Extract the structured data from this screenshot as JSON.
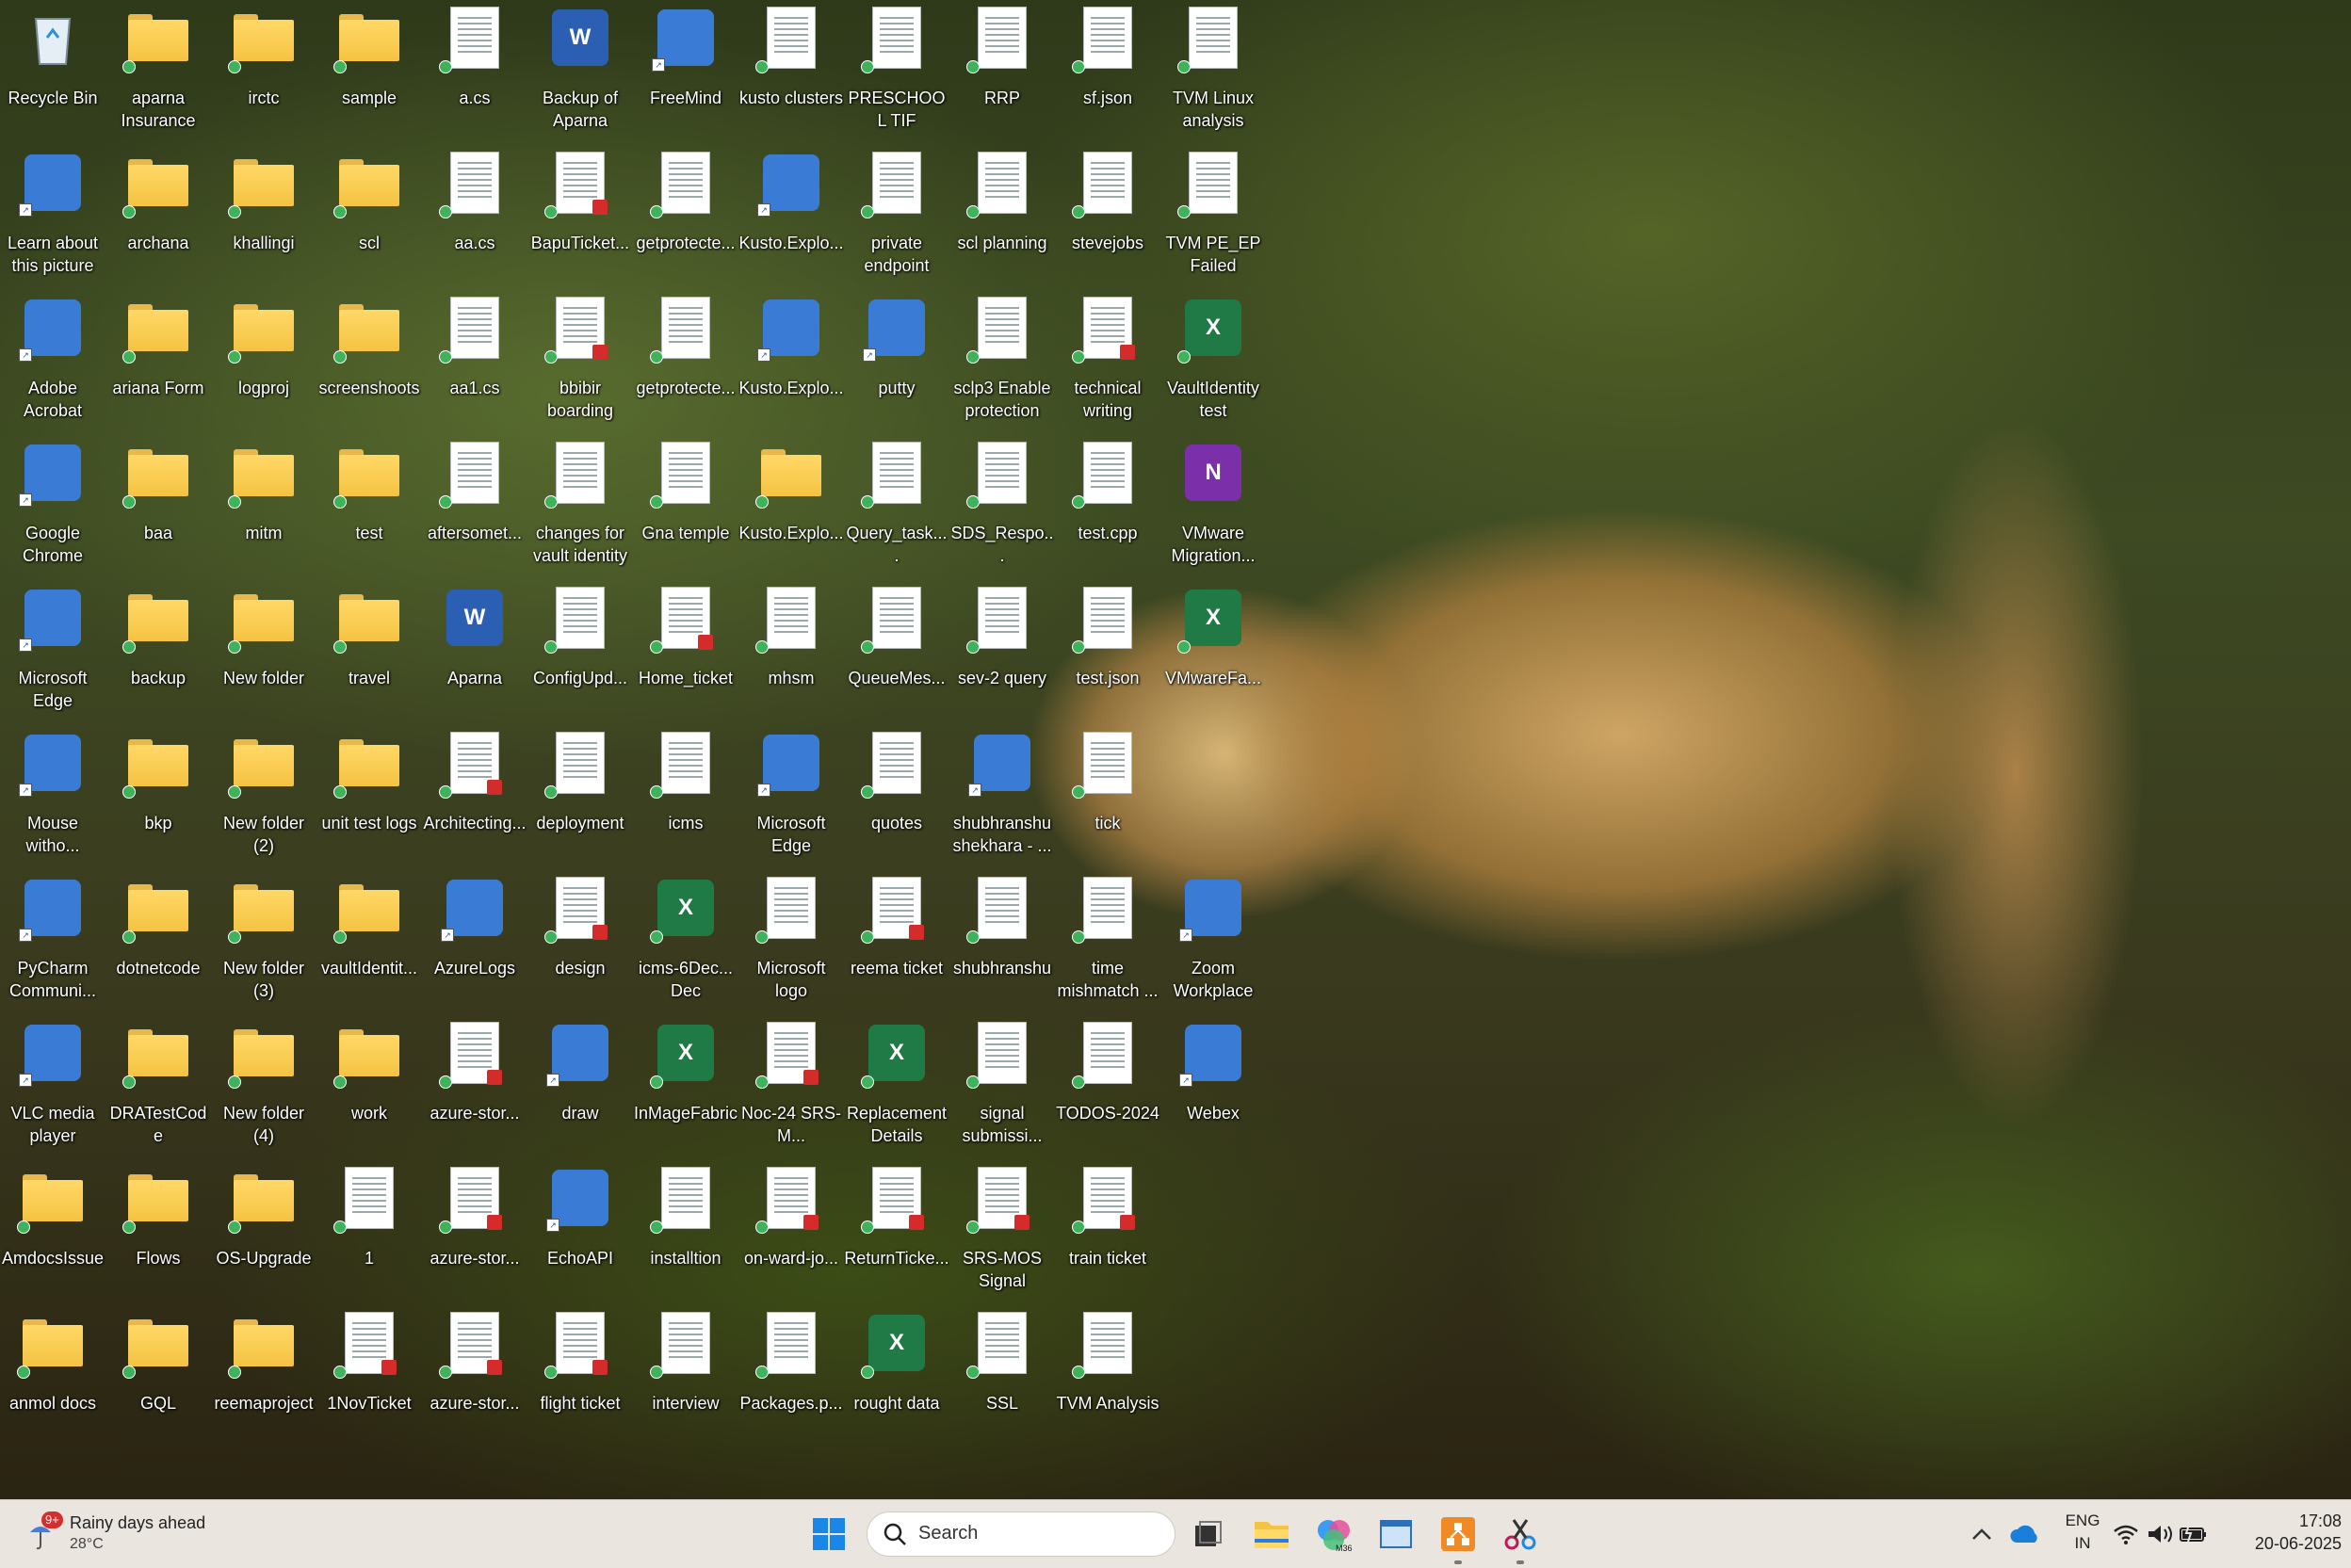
{
  "desktop": {
    "icons": [
      {
        "label": "Recycle Bin",
        "kind": "bin"
      },
      {
        "label": "aparna Insurance",
        "kind": "folder"
      },
      {
        "label": "irctc",
        "kind": "folder"
      },
      {
        "label": "sample",
        "kind": "folder"
      },
      {
        "label": "a.cs",
        "kind": "doc"
      },
      {
        "label": "Backup of Aparna",
        "kind": "word"
      },
      {
        "label": "FreeMind",
        "kind": "app"
      },
      {
        "label": "kusto clusters",
        "kind": "doc"
      },
      {
        "label": "PRESCHOOL TIF",
        "kind": "doc"
      },
      {
        "label": "RRP",
        "kind": "doc"
      },
      {
        "label": "sf.json",
        "kind": "doc"
      },
      {
        "label": "TVM Linux analysis",
        "kind": "doc"
      },
      {
        "label": "Learn about this picture",
        "kind": "app"
      },
      {
        "label": "archana",
        "kind": "folder"
      },
      {
        "label": "khallingi",
        "kind": "folder"
      },
      {
        "label": "scl",
        "kind": "folder"
      },
      {
        "label": "aa.cs",
        "kind": "doc"
      },
      {
        "label": "BapuTicket...",
        "kind": "pdf"
      },
      {
        "label": "getprotecte...",
        "kind": "doc"
      },
      {
        "label": "Kusto.Explo...",
        "kind": "app"
      },
      {
        "label": "private endpoint",
        "kind": "doc"
      },
      {
        "label": "scl planning",
        "kind": "doc"
      },
      {
        "label": "stevejobs",
        "kind": "doc"
      },
      {
        "label": "TVM PE_EP Failed",
        "kind": "doc"
      },
      {
        "label": "Adobe Acrobat",
        "kind": "app"
      },
      {
        "label": "ariana Form",
        "kind": "folder"
      },
      {
        "label": "logproj",
        "kind": "folder"
      },
      {
        "label": "screenshoots",
        "kind": "folder"
      },
      {
        "label": "aa1.cs",
        "kind": "doc"
      },
      {
        "label": "bbibir boarding",
        "kind": "pdf"
      },
      {
        "label": "getprotecte...",
        "kind": "doc"
      },
      {
        "label": "Kusto.Explo...",
        "kind": "app"
      },
      {
        "label": "putty",
        "kind": "app"
      },
      {
        "label": "sclp3 Enable protection",
        "kind": "doc"
      },
      {
        "label": "technical writing",
        "kind": "pdf"
      },
      {
        "label": "VaultIdentity test",
        "kind": "excel"
      },
      {
        "label": "Google Chrome",
        "kind": "app"
      },
      {
        "label": "baa",
        "kind": "folder"
      },
      {
        "label": "mitm",
        "kind": "folder"
      },
      {
        "label": "test",
        "kind": "folder"
      },
      {
        "label": "aftersomet...",
        "kind": "doc"
      },
      {
        "label": "changes for vault identity",
        "kind": "doc"
      },
      {
        "label": "Gna temple",
        "kind": "doc"
      },
      {
        "label": "Kusto.Explo...",
        "kind": "folder"
      },
      {
        "label": "Query_task....",
        "kind": "doc"
      },
      {
        "label": "SDS_Respo...",
        "kind": "doc"
      },
      {
        "label": "test.cpp",
        "kind": "doc"
      },
      {
        "label": "VMware Migration...",
        "kind": "onenote"
      },
      {
        "label": "Microsoft Edge",
        "kind": "app"
      },
      {
        "label": "backup",
        "kind": "folder"
      },
      {
        "label": "New folder",
        "kind": "folder"
      },
      {
        "label": "travel",
        "kind": "folder"
      },
      {
        "label": "Aparna",
        "kind": "word"
      },
      {
        "label": "ConfigUpd...",
        "kind": "doc"
      },
      {
        "label": "Home_ticket",
        "kind": "pdf"
      },
      {
        "label": "mhsm",
        "kind": "doc"
      },
      {
        "label": "QueueMes...",
        "kind": "doc"
      },
      {
        "label": "sev-2 query",
        "kind": "doc"
      },
      {
        "label": "test.json",
        "kind": "doc"
      },
      {
        "label": "VMwareFa...",
        "kind": "excel"
      },
      {
        "label": "Mouse witho...",
        "kind": "app"
      },
      {
        "label": "bkp",
        "kind": "folder"
      },
      {
        "label": "New folder (2)",
        "kind": "folder"
      },
      {
        "label": "unit test logs",
        "kind": "folder"
      },
      {
        "label": "Architecting...",
        "kind": "pdf"
      },
      {
        "label": "deployment",
        "kind": "doc"
      },
      {
        "label": "icms",
        "kind": "doc"
      },
      {
        "label": "Microsoft Edge",
        "kind": "app"
      },
      {
        "label": "quotes",
        "kind": "doc"
      },
      {
        "label": "shubhranshu shekhara - ...",
        "kind": "app"
      },
      {
        "label": "tick",
        "kind": "doc"
      },
      {
        "label": "",
        "kind": "none"
      },
      {
        "label": "PyCharm Communi...",
        "kind": "app"
      },
      {
        "label": "dotnetcode",
        "kind": "folder"
      },
      {
        "label": "New folder (3)",
        "kind": "folder"
      },
      {
        "label": "vaultIdentit...",
        "kind": "folder"
      },
      {
        "label": "AzureLogs",
        "kind": "app"
      },
      {
        "label": "design",
        "kind": "pdf"
      },
      {
        "label": "icms-6Dec... Dec",
        "kind": "excel"
      },
      {
        "label": "Microsoft logo",
        "kind": "doc"
      },
      {
        "label": "reema ticket",
        "kind": "pdf"
      },
      {
        "label": "shubhranshu",
        "kind": "doc"
      },
      {
        "label": "time mishmatch ...",
        "kind": "doc"
      },
      {
        "label": "Zoom Workplace",
        "kind": "app"
      },
      {
        "label": "VLC media player",
        "kind": "app"
      },
      {
        "label": "DRATestCode",
        "kind": "folder"
      },
      {
        "label": "New folder (4)",
        "kind": "folder"
      },
      {
        "label": "work",
        "kind": "folder"
      },
      {
        "label": "azure-stor...",
        "kind": "pdf"
      },
      {
        "label": "draw",
        "kind": "app"
      },
      {
        "label": "InMageFabric",
        "kind": "excel"
      },
      {
        "label": "Noc-24 SRS-M...",
        "kind": "pdf"
      },
      {
        "label": "Replacement Details",
        "kind": "excel"
      },
      {
        "label": "signal submissi...",
        "kind": "doc"
      },
      {
        "label": "TODOS-2024",
        "kind": "doc"
      },
      {
        "label": "Webex",
        "kind": "app"
      },
      {
        "label": "AmdocsIssue",
        "kind": "folder"
      },
      {
        "label": "Flows",
        "kind": "folder"
      },
      {
        "label": "OS-Upgrade",
        "kind": "folder"
      },
      {
        "label": "1",
        "kind": "doc"
      },
      {
        "label": "azure-stor...",
        "kind": "pdf"
      },
      {
        "label": "EchoAPI",
        "kind": "app"
      },
      {
        "label": "installtion",
        "kind": "doc"
      },
      {
        "label": "on-ward-jo...",
        "kind": "pdf"
      },
      {
        "label": "ReturnTicke...",
        "kind": "pdf"
      },
      {
        "label": "SRS-MOS Signal",
        "kind": "pdf"
      },
      {
        "label": "train ticket",
        "kind": "pdf"
      },
      {
        "label": "",
        "kind": "none"
      },
      {
        "label": "anmol docs",
        "kind": "folder"
      },
      {
        "label": "GQL",
        "kind": "folder"
      },
      {
        "label": "reemaproject",
        "kind": "folder"
      },
      {
        "label": "1NovTicket",
        "kind": "pdf"
      },
      {
        "label": "azure-stor...",
        "kind": "pdf"
      },
      {
        "label": "flight ticket",
        "kind": "pdf"
      },
      {
        "label": "interview",
        "kind": "doc"
      },
      {
        "label": "Packages.p...",
        "kind": "doc"
      },
      {
        "label": "rought data",
        "kind": "excel"
      },
      {
        "label": "SSL",
        "kind": "doc"
      },
      {
        "label": "TVM Analysis",
        "kind": "doc"
      },
      {
        "label": "",
        "kind": "none"
      }
    ]
  },
  "taskbar": {
    "weather": {
      "badge": "9+",
      "title": "Rainy days ahead",
      "temp": "28°C"
    },
    "search_placeholder": "Search",
    "apps": [
      "start-icon",
      "task-view-icon",
      "file-explorer-icon",
      "copilot-icon",
      "window-icon",
      "draw-icon",
      "snipping-tool-icon"
    ],
    "language": {
      "line1": "ENG",
      "line2": "IN"
    },
    "clock": {
      "time": "17:08",
      "date": "20-06-2025"
    }
  },
  "colors": {
    "taskbar_bg": "#eae6df",
    "folder": "#f5c343",
    "pdf_badge": "#d42b2b",
    "sync_check": "#3fb35b"
  }
}
